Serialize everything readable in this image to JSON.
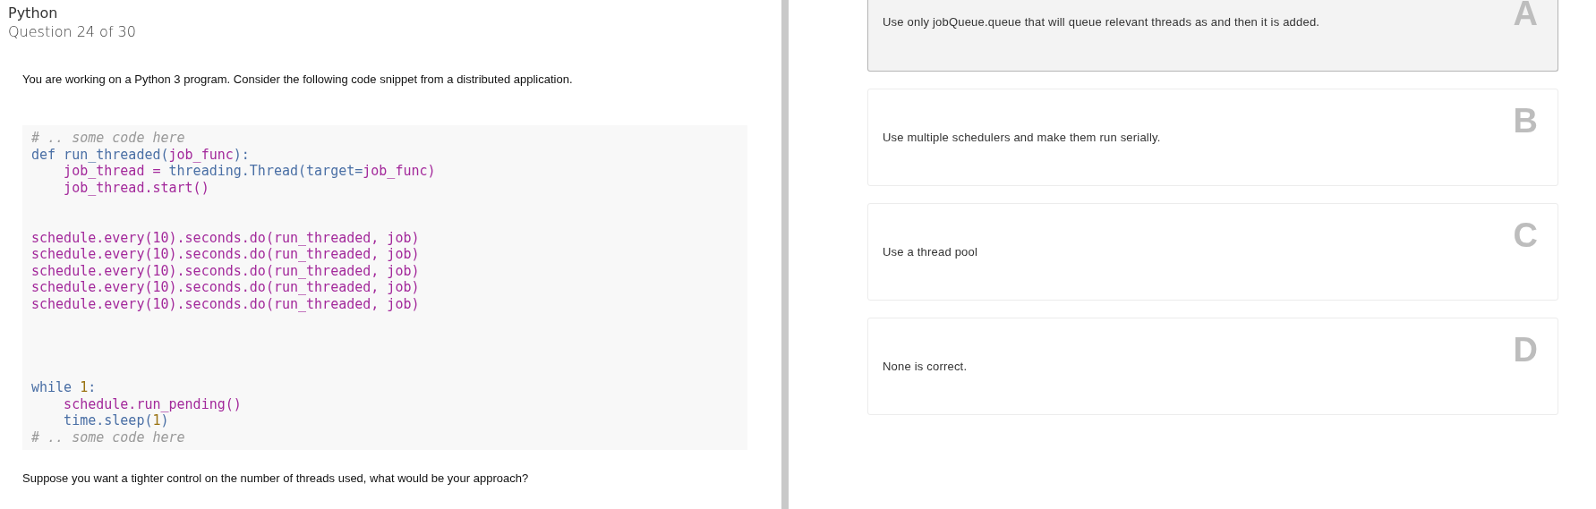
{
  "header": {
    "subject": "Python",
    "progress": "Question 24 of 30"
  },
  "prompt": "You are working on a Python 3 program. Consider the following code snippet from a distributed application.",
  "code": [
    {
      "tokens": [
        {
          "t": "# .. some code here",
          "kind": "comment"
        }
      ]
    },
    {
      "tokens": [
        {
          "t": "def run_threaded(",
          "kind": "keyword"
        },
        {
          "t": "job_func",
          "kind": "name"
        },
        {
          "t": "):",
          "kind": "keyword"
        }
      ]
    },
    {
      "tokens": [
        {
          "t": "    job_thread = ",
          "kind": "name"
        },
        {
          "t": "threading.Thread(target=",
          "kind": "keyword"
        },
        {
          "t": "job_func)",
          "kind": "name"
        }
      ]
    },
    {
      "tokens": [
        {
          "t": "    job_thread.start()",
          "kind": "name"
        }
      ]
    },
    {
      "blank": true
    },
    {
      "blank": true
    },
    {
      "tokens": [
        {
          "t": "schedule.every(10).seconds.do(run_threaded, job)",
          "kind": "name"
        }
      ]
    },
    {
      "tokens": [
        {
          "t": "schedule.every(10).seconds.do(run_threaded, job)",
          "kind": "name"
        }
      ]
    },
    {
      "tokens": [
        {
          "t": "schedule.every(10).seconds.do(run_threaded, job)",
          "kind": "name"
        }
      ]
    },
    {
      "tokens": [
        {
          "t": "schedule.every(10).seconds.do(run_threaded, job)",
          "kind": "name"
        }
      ]
    },
    {
      "tokens": [
        {
          "t": "schedule.every(10).seconds.do(run_threaded, job)",
          "kind": "name"
        }
      ]
    },
    {
      "blank": true
    },
    {
      "blank": true
    },
    {
      "blank": true
    },
    {
      "blank": true
    },
    {
      "tokens": [
        {
          "t": "while ",
          "kind": "keyword"
        },
        {
          "t": "1",
          "kind": "number"
        },
        {
          "t": ":",
          "kind": "keyword"
        }
      ]
    },
    {
      "tokens": [
        {
          "t": "    schedule.run_pending()",
          "kind": "name"
        }
      ]
    },
    {
      "tokens": [
        {
          "t": "    time.sleep(",
          "kind": "keyword"
        },
        {
          "t": "1",
          "kind": "number"
        },
        {
          "t": ")",
          "kind": "keyword"
        }
      ]
    },
    {
      "tokens": [
        {
          "t": "# .. some code here",
          "kind": "comment"
        }
      ]
    }
  ],
  "question": "Suppose you want a tighter control on the number of threads used, what would be your approach?",
  "options": [
    {
      "letter": "A",
      "text": "Use only jobQueue.queue that will queue relevant threads as and then it is added.",
      "selected": true
    },
    {
      "letter": "B",
      "text": "Use multiple schedulers and make them run serially.",
      "selected": false
    },
    {
      "letter": "C",
      "text": "Use a thread pool",
      "selected": false
    },
    {
      "letter": "D",
      "text": "None is correct.",
      "selected": false
    }
  ]
}
